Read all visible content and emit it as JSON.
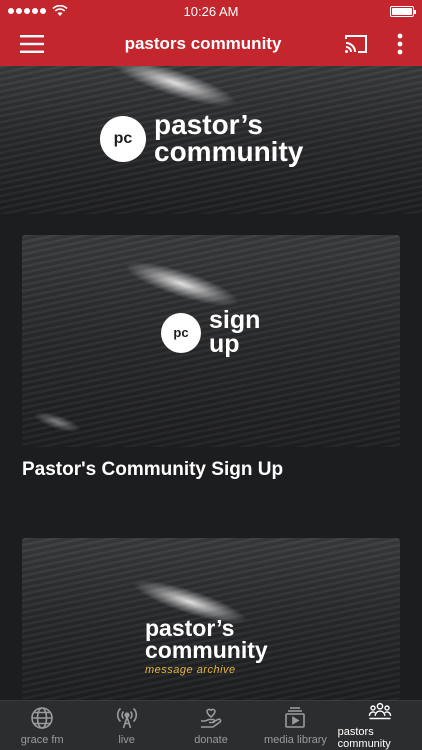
{
  "status_bar": {
    "time": "10:26 AM"
  },
  "nav": {
    "title": "pastors community"
  },
  "hero": {
    "badge": "pc",
    "line1": "pastor’s",
    "line2": "community"
  },
  "cards": [
    {
      "badge": "pc",
      "line1": "sign",
      "line2": "up",
      "title": "Pastor's Community Sign Up"
    },
    {
      "line1": "pastor’s",
      "line2": "community",
      "subtitle": "message archive"
    }
  ],
  "tabs": [
    {
      "label": "grace fm",
      "icon": "globe-icon",
      "active": false
    },
    {
      "label": "live",
      "icon": "broadcast-icon",
      "active": false
    },
    {
      "label": "donate",
      "icon": "donate-hand-icon",
      "active": false
    },
    {
      "label": "media library",
      "icon": "media-library-icon",
      "active": false
    },
    {
      "label": "pastors community",
      "icon": "people-group-icon",
      "active": true
    }
  ],
  "colors": {
    "brand_red": "#c4262e",
    "background": "#1c1d1f",
    "accent_gold": "#e3b342"
  }
}
